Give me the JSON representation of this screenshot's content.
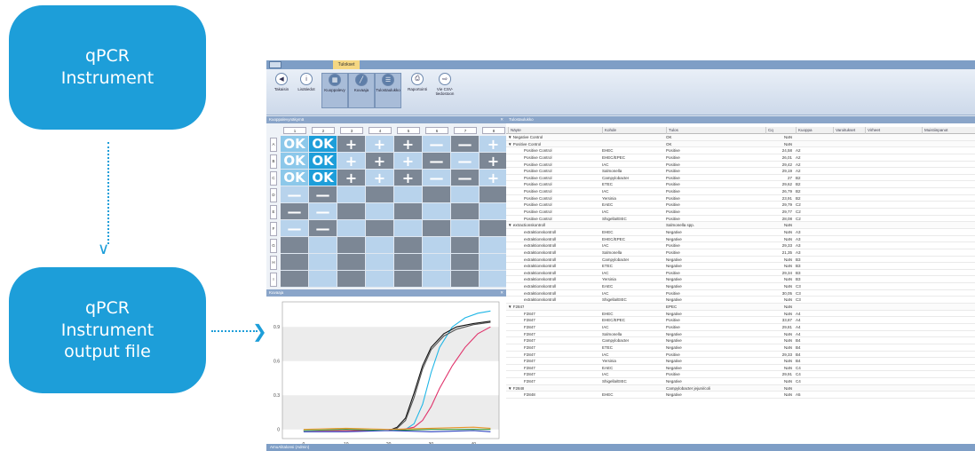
{
  "diagram": {
    "box1": [
      "qPCR",
      "Instrument"
    ],
    "box2": [
      "qPCR",
      "Instrument",
      "output file"
    ],
    "arrow_down": "∨",
    "arrow_right": "❯",
    "color": "#1d9ed9"
  },
  "app": {
    "tab": "Tulokset",
    "ribbon": [
      {
        "label": "Takaisin",
        "icon": "back-arrow-icon",
        "glyph": "◀"
      },
      {
        "label": "Lisätiedot",
        "icon": "info-icon",
        "glyph": "i"
      },
      {
        "label": "Kuoppalevy",
        "icon": "plate-icon",
        "glyph": "▦"
      },
      {
        "label": "Kuvaaja",
        "icon": "chart-icon",
        "glyph": "╱"
      },
      {
        "label": "Tulostaulukko",
        "icon": "table-icon",
        "glyph": "☰"
      },
      {
        "label": "Raportointi",
        "icon": "report-icon",
        "glyph": "⎙"
      },
      {
        "label": "Vie CSV-tiedostoon",
        "icon": "export-icon",
        "glyph": "⇨"
      }
    ],
    "plate_title": "Kuoppalevynäkymä",
    "curve_title": "Kuvaaja",
    "results_title": "Tulostaulukko",
    "status": "AmuAlitalonsi (Admin)",
    "plate_cols": [
      "1",
      "2",
      "3",
      "4",
      "5",
      "6",
      "7",
      "8"
    ],
    "plate_rows": [
      "A",
      "B",
      "C",
      "D",
      "E",
      "F",
      "G",
      "H",
      "I"
    ],
    "plate_wells": [
      [
        "OK",
        "OK",
        "+",
        "+",
        "+",
        "—",
        "—",
        "+"
      ],
      [
        "OK",
        "OK",
        "+",
        "+",
        "+",
        "—",
        "—",
        "+"
      ],
      [
        "OK",
        "OK",
        "+",
        "+",
        "+",
        "—",
        "—",
        "+"
      ],
      [
        "—",
        "—",
        "",
        "",
        "",
        "",
        "",
        ""
      ],
      [
        "—",
        "—",
        "",
        "",
        "",
        "",
        "",
        ""
      ],
      [
        "—",
        "—",
        "",
        "",
        "",
        "",
        "",
        ""
      ],
      [
        "",
        "",
        "",
        "",
        "",
        "",
        "",
        ""
      ],
      [
        "",
        "",
        "",
        "",
        "",
        "",
        "",
        ""
      ],
      [
        "",
        "",
        "",
        "",
        "",
        "",
        "",
        ""
      ]
    ],
    "columns": [
      "Näyte",
      "Kohde",
      "Tulos",
      "Cq",
      "Kuoppa",
      "Varoitukset",
      "Virheet",
      "Muistiinpanot"
    ],
    "rows": [
      {
        "g": 1,
        "n": "Negative Control",
        "k": "",
        "t": "OK",
        "cq": "NaN",
        "w": ""
      },
      {
        "g": 1,
        "n": "Positive Control",
        "k": "",
        "t": "OK",
        "cq": "NaN",
        "w": ""
      },
      {
        "g": 0,
        "n": "Positive Control",
        "k": "EHEC",
        "t": "Positive",
        "cq": "24,58",
        "w": "A2"
      },
      {
        "g": 0,
        "n": "Positive Control",
        "k": "EHEC/EPEC",
        "t": "Positive",
        "cq": "26,01",
        "w": "A2"
      },
      {
        "g": 0,
        "n": "Positive Control",
        "k": "IAC",
        "t": "Positive",
        "cq": "29,42",
        "w": "A2"
      },
      {
        "g": 0,
        "n": "Positive Control",
        "k": "Salmonella",
        "t": "Positive",
        "cq": "29,19",
        "w": "A2"
      },
      {
        "g": 0,
        "n": "Positive Control",
        "k": "Campylobacter",
        "t": "Positive",
        "cq": "27",
        "w": "B2"
      },
      {
        "g": 0,
        "n": "Positive Control",
        "k": "ETEC",
        "t": "Positive",
        "cq": "29,62",
        "w": "B2"
      },
      {
        "g": 0,
        "n": "Positive Control",
        "k": "IAC",
        "t": "Positive",
        "cq": "26,79",
        "w": "B2"
      },
      {
        "g": 0,
        "n": "Positive Control",
        "k": "Yersinia",
        "t": "Positive",
        "cq": "23,91",
        "w": "B2"
      },
      {
        "g": 0,
        "n": "Positive Control",
        "k": "EAEC",
        "t": "Positive",
        "cq": "29,79",
        "w": "C2"
      },
      {
        "g": 0,
        "n": "Positive Control",
        "k": "IAC",
        "t": "Positive",
        "cq": "29,77",
        "w": "C2"
      },
      {
        "g": 0,
        "n": "Positive Control",
        "k": "Shigella/EIEC",
        "t": "Positive",
        "cq": "28,08",
        "w": "C2"
      },
      {
        "g": 1,
        "n": "extractionskontroll",
        "k": "",
        "t": "Salmonella spp.",
        "cq": "NaN",
        "w": ""
      },
      {
        "g": 0,
        "n": "extraktionskontroll",
        "k": "EHEC",
        "t": "Negative",
        "cq": "NaN",
        "w": "A3"
      },
      {
        "g": 0,
        "n": "extraktionskontroll",
        "k": "EHEC/EPEC",
        "t": "Negative",
        "cq": "NaN",
        "w": "A3"
      },
      {
        "g": 0,
        "n": "extraktionskontroll",
        "k": "IAC",
        "t": "Positive",
        "cq": "29,33",
        "w": "A3"
      },
      {
        "g": 0,
        "n": "extraktionskontroll",
        "k": "Salmonella",
        "t": "Positive",
        "cq": "21,35",
        "w": "A3"
      },
      {
        "g": 0,
        "n": "extraktionskontroll",
        "k": "Campylobacter",
        "t": "Negative",
        "cq": "NaN",
        "w": "B3"
      },
      {
        "g": 0,
        "n": "extraktionskontroll",
        "k": "ETEC",
        "t": "Negative",
        "cq": "NaN",
        "w": "B3"
      },
      {
        "g": 0,
        "n": "extraktionskontroll",
        "k": "IAC",
        "t": "Positive",
        "cq": "29,34",
        "w": "B3"
      },
      {
        "g": 0,
        "n": "extraktionskontroll",
        "k": "Yersinia",
        "t": "Negative",
        "cq": "NaN",
        "w": "B3"
      },
      {
        "g": 0,
        "n": "extraktionskontroll",
        "k": "EAEC",
        "t": "Negative",
        "cq": "NaN",
        "w": "C3"
      },
      {
        "g": 0,
        "n": "extraktionskontroll",
        "k": "IAC",
        "t": "Positive",
        "cq": "30,05",
        "w": "C3"
      },
      {
        "g": 0,
        "n": "extraktionskontroll",
        "k": "Shigella/EIEC",
        "t": "Negative",
        "cq": "NaN",
        "w": "C3"
      },
      {
        "g": 1,
        "n": "F2847",
        "k": "",
        "t": "EPEC",
        "cq": "NaN",
        "w": ""
      },
      {
        "g": 0,
        "n": "F2847",
        "k": "EHEC",
        "t": "Negative",
        "cq": "NaN",
        "w": "A4"
      },
      {
        "g": 0,
        "n": "F2847",
        "k": "EHEC/EPEC",
        "t": "Positive",
        "cq": "33,87",
        "w": "A4"
      },
      {
        "g": 0,
        "n": "F2847",
        "k": "IAC",
        "t": "Positive",
        "cq": "29,81",
        "w": "A4"
      },
      {
        "g": 0,
        "n": "F2847",
        "k": "Salmonella",
        "t": "Negative",
        "cq": "NaN",
        "w": "A4"
      },
      {
        "g": 0,
        "n": "F2847",
        "k": "Campylobacter",
        "t": "Negative",
        "cq": "NaN",
        "w": "B4"
      },
      {
        "g": 0,
        "n": "F2847",
        "k": "ETEC",
        "t": "Negative",
        "cq": "NaN",
        "w": "B4"
      },
      {
        "g": 0,
        "n": "F2847",
        "k": "IAC",
        "t": "Positive",
        "cq": "29,33",
        "w": "B4"
      },
      {
        "g": 0,
        "n": "F2847",
        "k": "Yersinia",
        "t": "Negative",
        "cq": "NaN",
        "w": "B4"
      },
      {
        "g": 0,
        "n": "F2847",
        "k": "EAEC",
        "t": "Negative",
        "cq": "NaN",
        "w": "C4"
      },
      {
        "g": 0,
        "n": "F2847",
        "k": "IAC",
        "t": "Positive",
        "cq": "29,91",
        "w": "C4"
      },
      {
        "g": 0,
        "n": "F2847",
        "k": "Shigella/EIEC",
        "t": "Negative",
        "cq": "NaN",
        "w": "C4"
      },
      {
        "g": 1,
        "n": "F2848",
        "k": "",
        "t": "Campylobacter jejuni/coli",
        "cq": "NaN",
        "w": ""
      },
      {
        "g": 0,
        "n": "F2848",
        "k": "EHEC",
        "t": "Negative",
        "cq": "NaN",
        "w": "A5"
      }
    ]
  },
  "chart_data": {
    "type": "line",
    "title": "",
    "xlabel": "",
    "ylabel": "",
    "x_ticks": [
      0,
      10,
      20,
      30,
      40
    ],
    "y_ticks": [
      0,
      0.3,
      0.6,
      0.9
    ],
    "xlim": [
      -5,
      46
    ],
    "ylim": [
      -0.08,
      1.12
    ],
    "series": [
      {
        "color": "#1fb6e6",
        "x": [
          0,
          20,
          24,
          26,
          28,
          30,
          32,
          35,
          38,
          41,
          44
        ],
        "y": [
          -0.01,
          -0.01,
          0.0,
          0.05,
          0.22,
          0.5,
          0.72,
          0.9,
          0.98,
          1.02,
          1.04
        ]
      },
      {
        "color": "#111111",
        "x": [
          0,
          20,
          22,
          24,
          26,
          28,
          30,
          33,
          36,
          40,
          44
        ],
        "y": [
          -0.01,
          -0.01,
          0.02,
          0.1,
          0.32,
          0.56,
          0.72,
          0.84,
          0.9,
          0.93,
          0.95
        ]
      },
      {
        "color": "#555555",
        "x": [
          0,
          20,
          22,
          24,
          26,
          28,
          30,
          33,
          36,
          40,
          44
        ],
        "y": [
          -0.01,
          -0.01,
          0.01,
          0.08,
          0.28,
          0.53,
          0.7,
          0.82,
          0.88,
          0.92,
          0.94
        ]
      },
      {
        "color": "#e0336b",
        "x": [
          0,
          22,
          26,
          28,
          30,
          32,
          35,
          38,
          41,
          44
        ],
        "y": [
          -0.01,
          -0.01,
          0.02,
          0.08,
          0.2,
          0.36,
          0.56,
          0.72,
          0.84,
          0.9
        ]
      },
      {
        "color": "#e8962a",
        "x": [
          0,
          10,
          20,
          30,
          40,
          44
        ],
        "y": [
          0.0,
          0.01,
          0.0,
          0.01,
          0.02,
          0.01
        ]
      },
      {
        "color": "#3a9b3a",
        "x": [
          0,
          10,
          20,
          30,
          40,
          44
        ],
        "y": [
          -0.01,
          0.0,
          -0.01,
          0.0,
          0.0,
          0.0
        ]
      },
      {
        "color": "#2a3fbf",
        "x": [
          0,
          10,
          20,
          30,
          40,
          44
        ],
        "y": [
          -0.02,
          -0.02,
          -0.01,
          -0.02,
          -0.01,
          -0.02
        ]
      }
    ]
  }
}
